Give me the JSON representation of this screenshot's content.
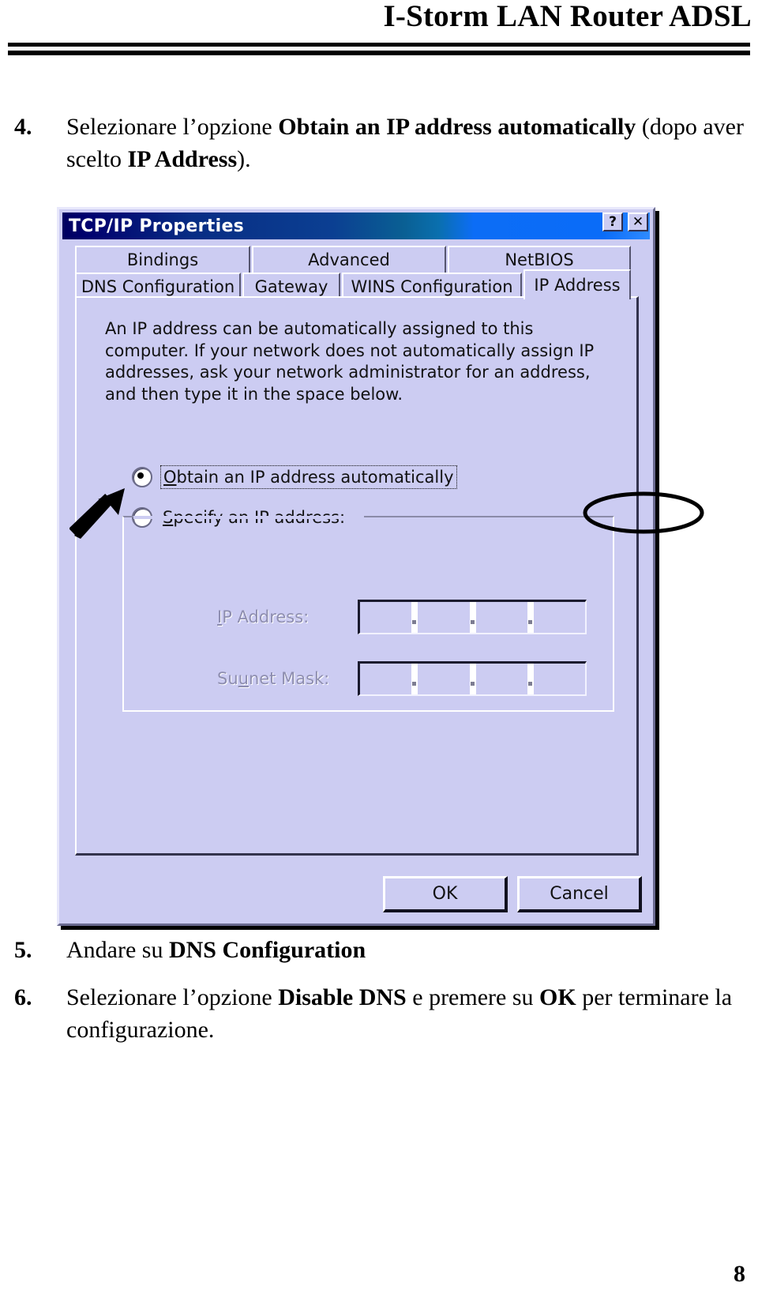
{
  "header": {
    "title": "I-Storm LAN Router ADSL"
  },
  "page_number": "8",
  "steps": [
    {
      "number": "4.",
      "parts": [
        {
          "text": "Selezionare l’opzione ",
          "bold": false
        },
        {
          "text": "Obtain an IP address automatically",
          "bold": true
        },
        {
          "text": " (dopo aver scelto ",
          "bold": false
        },
        {
          "text": "IP Address",
          "bold": true
        },
        {
          "text": ").",
          "bold": false
        }
      ]
    },
    {
      "number": "5.",
      "parts": [
        {
          "text": "Andare su ",
          "bold": false
        },
        {
          "text": "DNS Configuration",
          "bold": true
        }
      ]
    },
    {
      "number": "6.",
      "parts": [
        {
          "text": "Selezionare l’opzione ",
          "bold": false
        },
        {
          "text": "Disable DNS",
          "bold": true
        },
        {
          "text": " e premere su  ",
          "bold": false
        },
        {
          "text": "OK",
          "bold": true
        },
        {
          "text": " per terminare la configurazione.",
          "bold": false
        }
      ]
    }
  ],
  "dialog": {
    "title": "TCP/IP Properties",
    "titlebar_buttons": [
      {
        "name": "help-button",
        "glyph": "?"
      },
      {
        "name": "close-button",
        "glyph": "✕"
      }
    ],
    "tabs_row1": [
      "Bindings",
      "Advanced",
      "NetBIOS"
    ],
    "tabs_row2": [
      "DNS Configuration",
      "Gateway",
      "WINS Configuration",
      "IP Address"
    ],
    "active_tab": "IP Address",
    "description": "An IP address can be automatically assigned to this computer. If your network does not automatically assign IP addresses, ask your network administrator for an address, and then type it in the space below.",
    "radios": [
      {
        "label": "Obtain an IP address automatically",
        "accel": "O",
        "checked": true,
        "focused": true
      },
      {
        "label": "Specify an IP address:",
        "accel": "S",
        "checked": false,
        "focused": false
      }
    ],
    "fields": [
      {
        "label": "IP Address:",
        "accel": "I",
        "value": "",
        "segments": [
          "",
          "",
          "",
          ""
        ],
        "enabled": false
      },
      {
        "label": "Subnet Mask:",
        "accel": "u",
        "value": "",
        "segments": [
          "",
          "",
          "",
          ""
        ],
        "enabled": false
      }
    ],
    "buttons": [
      {
        "label": "OK",
        "default": true
      },
      {
        "label": "Cancel",
        "default": false
      }
    ],
    "colors": {
      "face": "#ccccf2",
      "titlebar_start": "#000060",
      "titlebar_end": "#0a6cf8",
      "disabled_text": "#8d8daf"
    }
  },
  "annotations": {
    "arrow": "hand-drawn black arrow pointing to the Obtain an IP address automatically radio button",
    "ellipse": "hand-drawn black ellipse circling the IP Address tab"
  }
}
